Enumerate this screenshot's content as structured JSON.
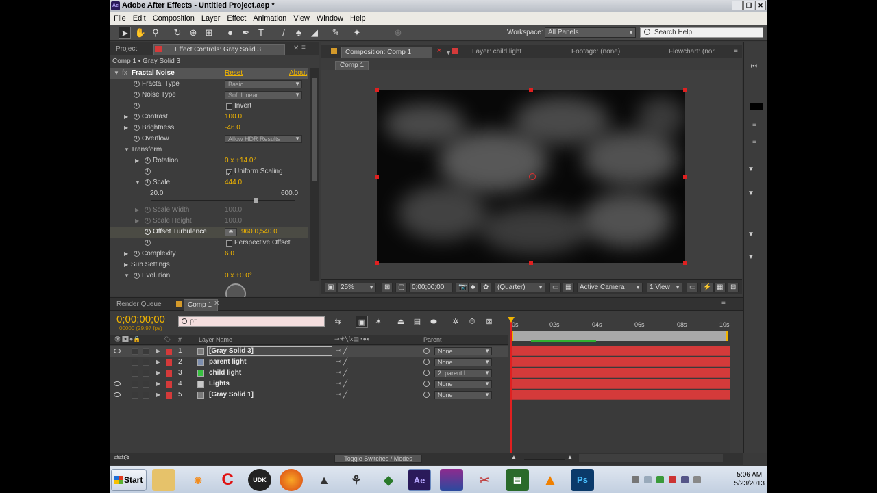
{
  "window": {
    "title": "Adobe After Effects - Untitled Project.aep *",
    "icon": "Ae"
  },
  "menu": [
    "File",
    "Edit",
    "Composition",
    "Layer",
    "Effect",
    "Animation",
    "View",
    "Window",
    "Help"
  ],
  "toolbar": {
    "workspace_label": "Workspace:",
    "workspace_value": "All Panels",
    "search_placeholder": "Search Help"
  },
  "left_panel": {
    "tabs": [
      "Project",
      "Effect Controls: Gray Solid 3"
    ],
    "header": "Comp 1 • Gray Solid 3",
    "effect": {
      "name": "Fractal Noise",
      "reset": "Reset",
      "about": "About"
    },
    "props": {
      "fractal_type_label": "Fractal Type",
      "fractal_type_value": "Basic",
      "noise_type_label": "Noise Type",
      "noise_type_value": "Soft Linear",
      "invert_label": "Invert",
      "contrast_label": "Contrast",
      "contrast_value": "100.0",
      "brightness_label": "Brightness",
      "brightness_value": "-46.0",
      "overflow_label": "Overflow",
      "overflow_value": "Allow HDR Results",
      "transform_label": "Transform",
      "rotation_label": "Rotation",
      "rotation_value": "0 x +14.0°",
      "uniform_label": "Uniform Scaling",
      "scale_label": "Scale",
      "scale_value": "444.0",
      "scale_min": "20.0",
      "scale_max": "600.0",
      "scale_fraction": 0.73,
      "scale_width_label": "Scale Width",
      "scale_width_value": "100.0",
      "scale_height_label": "Scale Height",
      "scale_height_value": "100.0",
      "offset_label": "Offset Turbulence",
      "offset_value": "960.0,540.0",
      "perspective_label": "Perspective Offset",
      "complexity_label": "Complexity",
      "complexity_value": "6.0",
      "sub_settings_label": "Sub Settings",
      "evolution_label": "Evolution",
      "evolution_value": "0 x +0.0°"
    }
  },
  "comp_panel": {
    "tabs": [
      "Composition: Comp 1",
      "Layer: child light",
      "Footage: (none)",
      "Flowchart: (nor"
    ],
    "breadcrumb": "Comp 1",
    "zoom": "25%",
    "timecode": "0;00;00;00",
    "resolution": "(Quarter)",
    "camera": "Active Camera",
    "views": "1 View"
  },
  "timeline": {
    "tabs": [
      "Render Queue",
      "Comp 1"
    ],
    "timecode": "0;00;00;00",
    "timecode_sub": "00000 (29.97 fps)",
    "search_placeholder": "ρ⁻",
    "col_layer_name": "Layer Name",
    "col_parent": "Parent",
    "col_num": "#",
    "ticks": [
      "0s",
      "02s",
      "04s",
      "06s",
      "08s",
      "10s"
    ],
    "toggle_label": "Toggle Switches / Modes",
    "layers": [
      {
        "num": "1",
        "name": "[Gray Solid 3]",
        "parent": "None",
        "color": "#d43a3a",
        "icon_color": "#7a7a7a"
      },
      {
        "num": "2",
        "name": "parent light",
        "parent": "None",
        "color": "#d43a3a",
        "icon_color": "#7d8eae"
      },
      {
        "num": "3",
        "name": "child light",
        "parent": "2. parent l...",
        "color": "#d43a3a",
        "icon_color": "#38c040"
      },
      {
        "num": "4",
        "name": "Lights",
        "parent": "None",
        "color": "#d43a3a",
        "icon_color": "#c8c8c8"
      },
      {
        "num": "5",
        "name": "[Gray Solid 1]",
        "parent": "None",
        "color": "#d43a3a",
        "icon_color": "#7a7a7a"
      }
    ]
  },
  "taskbar": {
    "start": "Start",
    "time": "5:06 AM",
    "date": "5/23/2013",
    "udk": "UDK",
    "ae": "Ae",
    "ps": "Ps"
  }
}
